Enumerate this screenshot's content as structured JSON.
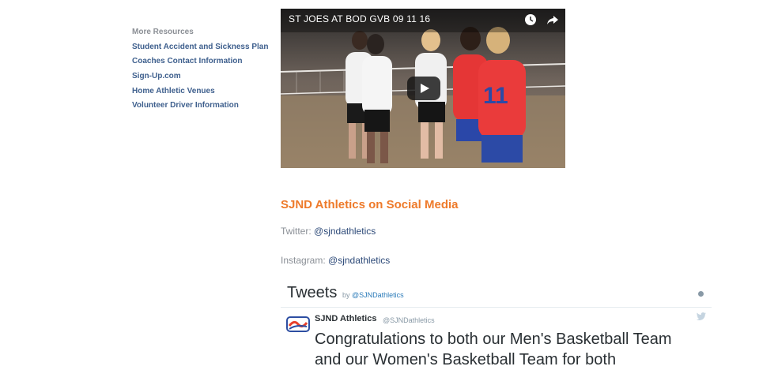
{
  "sidebar": {
    "heading": "More Resources",
    "links": [
      "Student Accident and Sickness Plan",
      "Coaches Contact Information",
      "Sign-Up.com",
      "Home Athletic Venues",
      "Volunteer Driver Information"
    ]
  },
  "video": {
    "title": "ST JOES AT BOD GVB 09 11 16",
    "jersey_number": "11"
  },
  "social": {
    "heading": "SJND Athletics on Social Media",
    "twitter_label": "Twitter: ",
    "twitter_handle": "@sjndathletics",
    "instagram_label": "Instagram: ",
    "instagram_handle": "@sjndathletics"
  },
  "tweets": {
    "title": "Tweets",
    "by_label": "by",
    "by_handle": "@SJNDathletics",
    "tweet": {
      "name": "SJND Athletics",
      "handle": "@SJNDathletics",
      "text": "Congratulations to both our Men's Basketball Team and our Women's Basketball Team for both"
    }
  },
  "colors": {
    "link": "#3e5f8d",
    "heading_orange": "#ee7a2a",
    "twitter_blue": "#2b7bb9"
  }
}
